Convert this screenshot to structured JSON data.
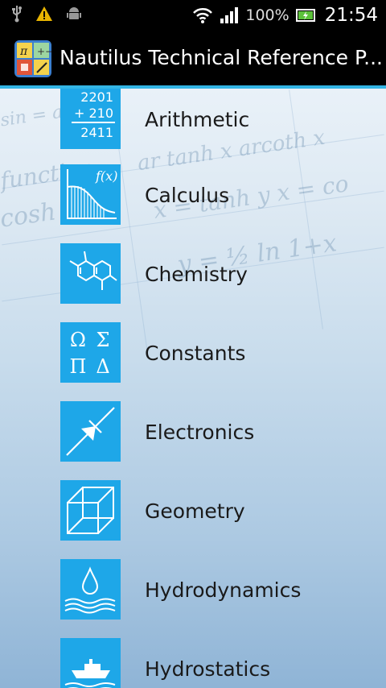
{
  "status_bar": {
    "icons": [
      "usb-icon",
      "warning-icon",
      "android-debug-icon",
      "wifi-icon",
      "signal-icon",
      "battery-charging-icon"
    ],
    "battery_text": "100%",
    "time": "21:54"
  },
  "action_bar": {
    "title": "Nautilus Technical Reference P...",
    "icon": "app-icon"
  },
  "menu": {
    "items": [
      {
        "label": "Arithmetic",
        "icon": "arithmetic-icon",
        "icon_text": [
          "2201",
          "+ 210",
          "2411"
        ]
      },
      {
        "label": "Calculus",
        "icon": "calculus-icon",
        "icon_text": [
          "f(x)"
        ]
      },
      {
        "label": "Chemistry",
        "icon": "chemistry-icon"
      },
      {
        "label": "Constants",
        "icon": "constants-icon",
        "icon_text": [
          "Ω",
          "Σ",
          "Π",
          "Δ"
        ]
      },
      {
        "label": "Electronics",
        "icon": "electronics-icon"
      },
      {
        "label": "Geometry",
        "icon": "geometry-icon"
      },
      {
        "label": "Hydrodynamics",
        "icon": "hydrodynamics-icon"
      },
      {
        "label": "Hydrostatics",
        "icon": "hydrostatics-icon"
      }
    ]
  },
  "colors": {
    "tile": "#1ea7e8",
    "accent": "#33b5e5"
  }
}
